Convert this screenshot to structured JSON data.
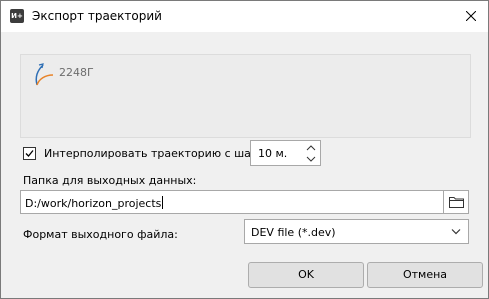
{
  "window": {
    "title": "Экспорт траекторий",
    "app_icon_text": "И+"
  },
  "preview": {
    "trajectory_name": "2248Г"
  },
  "interpolation": {
    "checked": true,
    "label": "Интерполировать траекторию с шагом",
    "step_value": "10 м."
  },
  "output_folder": {
    "label": "Папка для выходных данных:",
    "path": "D:/work/horizon_projects"
  },
  "output_format": {
    "label": "Формат выходного файла:",
    "selected": "DEV file (*.dev)"
  },
  "buttons": {
    "ok": "OK",
    "cancel": "Отмена"
  },
  "colors": {
    "trajectory_blue": "#2f6fb5",
    "trajectory_orange": "#e8842a"
  },
  "icons": [
    "close-icon",
    "trajectory-icon",
    "checkmark-icon",
    "spin-up-icon",
    "spin-down-icon",
    "folder-icon",
    "dropdown-arrow-icon"
  ]
}
